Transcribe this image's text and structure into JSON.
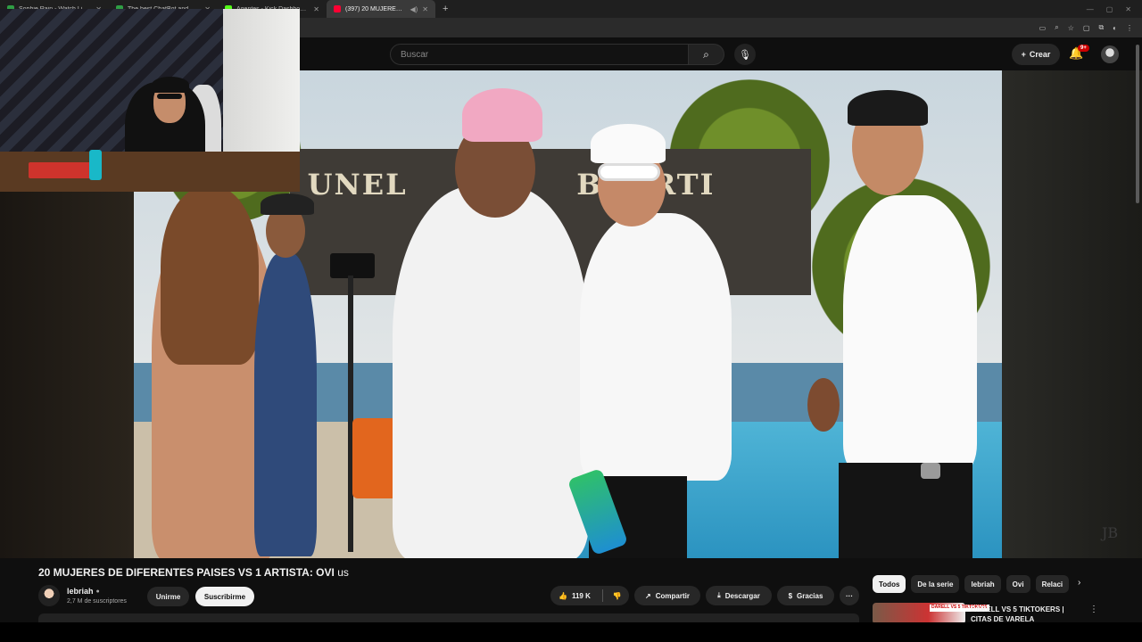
{
  "browser": {
    "tabs": [
      {
        "title": "Sophie Rain - Watch Live o...",
        "fav": "#2f9e44"
      },
      {
        "title": "The best ChatBot and Widgets",
        "fav": "#2f9e44"
      },
      {
        "title": "Agentes - Kick Dashboard",
        "fav": "#53fc18"
      },
      {
        "title": "(397) 20 MUJERES DE DIFE...",
        "fav": "#ff0033",
        "active": true
      }
    ],
    "new_tab": "+",
    "window_controls": [
      "—",
      "▢",
      "✕"
    ],
    "toolbar_icons": [
      "cast-icon",
      "zoom-icon",
      "star-icon",
      "screenshot-icon",
      "extensions-icon",
      "profile-icon",
      "menu-icon"
    ]
  },
  "youtube": {
    "search_placeholder": "Buscar",
    "create_label": "Crear",
    "notification_count": "9+"
  },
  "video": {
    "sign_left": "UNEL",
    "sign_right": "BBERTI",
    "watermark": "JB"
  },
  "info": {
    "title": "20 MUJERES DE DIFERENTES PAISES VS 1 ARTISTA: OVI",
    "title_tag": "us",
    "channel_name": "lebriah",
    "subscribers": "2,7 M de suscriptores",
    "join_label": "Unirme",
    "subscribe_label": "Suscribirme",
    "likes": "119 K",
    "share_label": "Compartir",
    "download_label": "Descargar",
    "thanks_label": "Gracias",
    "more_label": "···"
  },
  "sidebar": {
    "chips": [
      "Todos",
      "De la serie",
      "lebriah",
      "Ovi",
      "Relaci"
    ],
    "rec_title": "DARELL VS 5 TIKTOKERS | CITAS DE VARELA",
    "rec_thumb_text": "DARELL VS 5 TIKTOKERS"
  }
}
